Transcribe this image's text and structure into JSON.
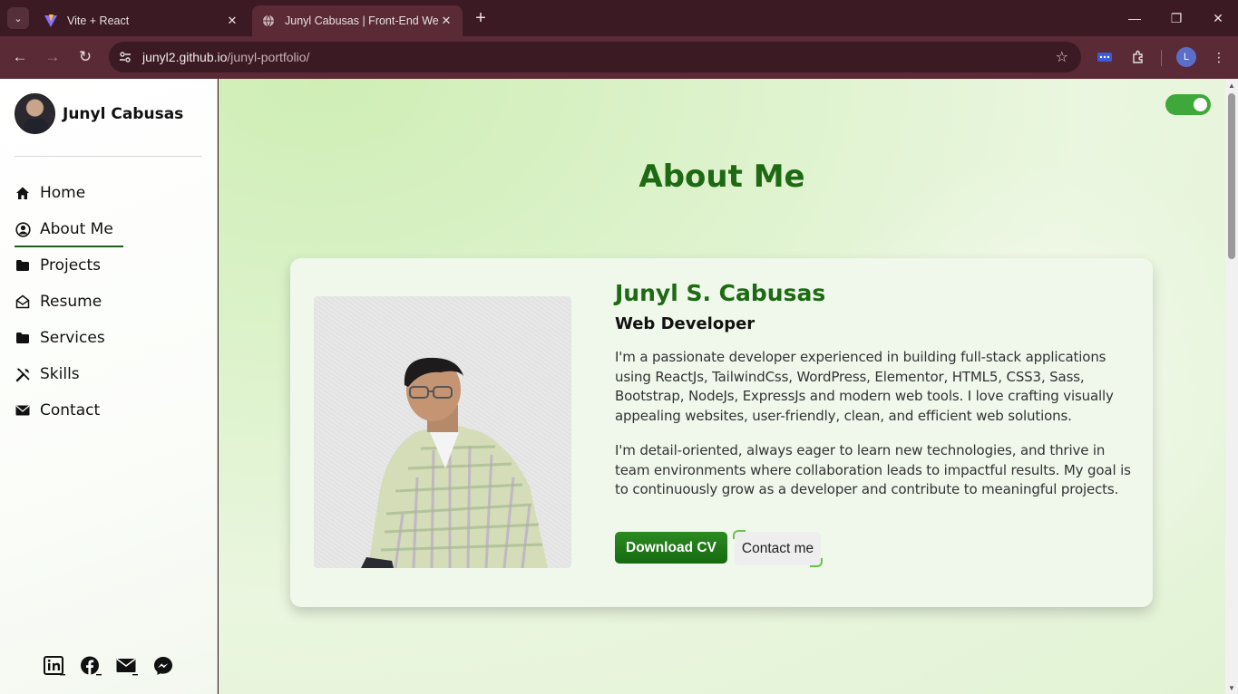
{
  "browser": {
    "tabs": [
      {
        "title": "Vite + React",
        "active": false
      },
      {
        "title": "Junyl Cabusas | Front-End Web",
        "active": true
      }
    ],
    "url_domain": "junyl2.github.io",
    "url_path": "/junyl-portfolio/",
    "profile_initial": "L"
  },
  "sidebar": {
    "brand_name": "Junyl Cabusas",
    "items": [
      {
        "label": "Home",
        "icon": "home-icon"
      },
      {
        "label": "About Me",
        "icon": "user-circle-icon",
        "active": true
      },
      {
        "label": "Projects",
        "icon": "folder-icon"
      },
      {
        "label": "Resume",
        "icon": "envelope-open-icon"
      },
      {
        "label": "Services",
        "icon": "folder-icon"
      },
      {
        "label": "Skills",
        "icon": "tools-icon"
      },
      {
        "label": "Contact",
        "icon": "envelope-icon"
      }
    ],
    "socials": [
      "linkedin-icon",
      "facebook-icon",
      "email-icon",
      "messenger-icon"
    ]
  },
  "main": {
    "theme_toggle_on": true,
    "page_title": "About Me",
    "name": "Junyl S. Cabusas",
    "role": "Web Developer",
    "paragraphs": [
      "I'm a passionate developer experienced in building full-stack applications using ReactJs, TailwindCss, WordPress, Elementor, HTML5, CSS3, Sass, Bootstrap, NodeJs, ExpressJs and modern web tools. I love crafting visually appealing websites, user-friendly, clean, and efficient web solutions.",
      "I'm detail-oriented, always eager to learn new technologies, and thrive in team environments where collaboration leads to impactful results. My goal is to continuously grow as a developer and contribute to meaningful projects."
    ],
    "download_cv_label": "Download CV",
    "contact_label": "Contact me"
  },
  "colors": {
    "accent_green": "#1e6a14",
    "toggle_green": "#3fa83a",
    "browser_frame": "#5a2a36"
  }
}
